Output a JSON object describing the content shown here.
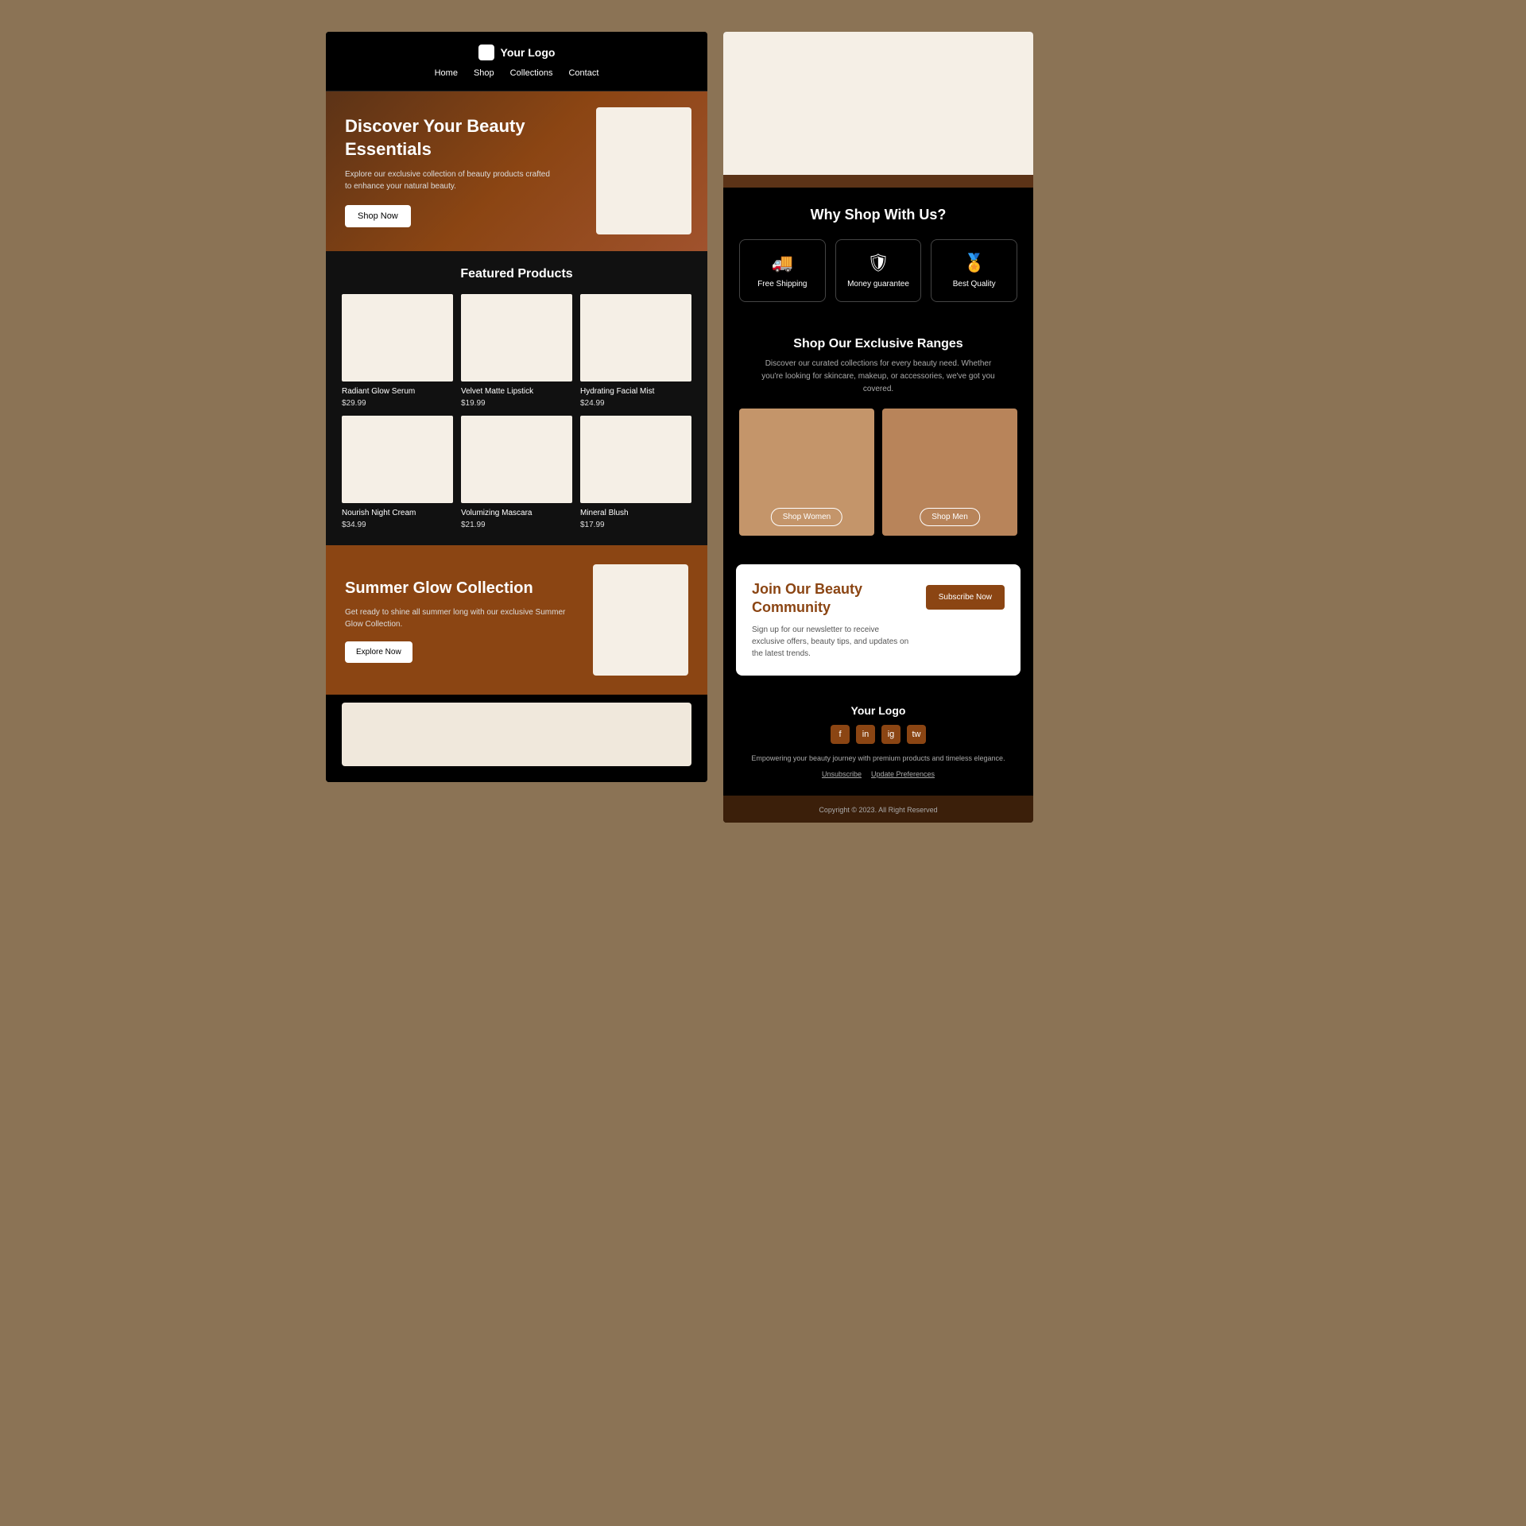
{
  "brand": {
    "logo_text": "Your Logo",
    "footer_logo": "Your Logo",
    "tagline": "Empowering your beauty journey with premium products and timeless elegance."
  },
  "nav": {
    "links": [
      "Home",
      "Shop",
      "Collections",
      "Contact"
    ]
  },
  "hero": {
    "title": "Discover Your Beauty Essentials",
    "description": "Explore our exclusive collection of beauty products crafted to enhance your natural beauty.",
    "cta": "Shop Now"
  },
  "featured": {
    "title": "Featured Products",
    "products": [
      {
        "name": "Radiant Glow Serum",
        "price": "$29.99"
      },
      {
        "name": "Velvet Matte Lipstick",
        "price": "$19.99"
      },
      {
        "name": "Hydrating Facial Mist",
        "price": "$24.99"
      },
      {
        "name": "Nourish Night Cream",
        "price": "$34.99"
      },
      {
        "name": "Volumizing Mascara",
        "price": "$21.99"
      },
      {
        "name": "Mineral Blush",
        "price": "$17.99"
      }
    ]
  },
  "summer": {
    "title": "Summer Glow Collection",
    "description": "Get ready to shine all summer long with our exclusive Summer Glow Collection.",
    "cta": "Explore Now"
  },
  "why_shop": {
    "title": "Why Shop With Us?",
    "features": [
      {
        "label": "Free Shipping",
        "icon": "🚚"
      },
      {
        "label": "Money guarantee",
        "icon": "🛡"
      },
      {
        "label": "Best Quality",
        "icon": "🏅"
      }
    ]
  },
  "ranges": {
    "title": "Shop Our Exclusive Ranges",
    "description": "Discover our curated collections for every beauty need. Whether you're looking for skincare, makeup, or accessories, we've got you covered.",
    "categories": [
      {
        "label": "Shop Women",
        "btn": "Shop Women"
      },
      {
        "label": "Shop Men",
        "btn": "Shop Men"
      }
    ]
  },
  "community": {
    "title": "Join Our Beauty Community",
    "description": "Sign up for our newsletter to receive exclusive offers, beauty tips, and updates on the latest trends.",
    "cta": "Subscribe Now"
  },
  "footer": {
    "social_icons": [
      "f",
      "in",
      "ig",
      "tw"
    ],
    "links": [
      "Unsubscribe",
      "Update Preferences"
    ],
    "copyright": "Copyright © 2023. All Right Reserved"
  }
}
